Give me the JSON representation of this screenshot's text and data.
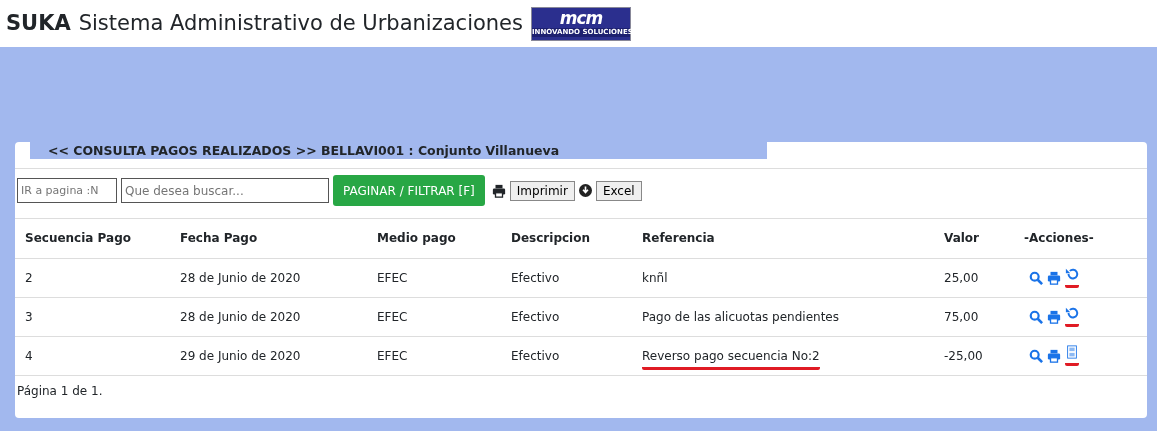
{
  "header": {
    "brand": "SUKA",
    "title": "Sistema Administrativo de Urbanizaciones",
    "logo": {
      "name": "mcm",
      "tagline": "INNOVANDO SOLUCIONES"
    }
  },
  "panel": {
    "title": "<< CONSULTA PAGOS REALIZADOS >> BELLAVI001 : Conjunto Villanueva"
  },
  "toolbar": {
    "page_field": {
      "placeholder": "IR a pagina :N"
    },
    "search_field": {
      "placeholder": "Que desea buscar..."
    },
    "filter_button": "PAGINAR / FILTRAR [F]",
    "print_button": "Imprimir",
    "excel_button": "Excel"
  },
  "table": {
    "columns": [
      "Secuencia Pago",
      "Fecha Pago",
      "Medio pago",
      "Descripcion",
      "Referencia",
      "Valor",
      "-Acciones-"
    ],
    "rows": [
      {
        "cells": [
          "2",
          "28 de Junio de 2020",
          "EFEC",
          "Efectivo",
          "knñl",
          "25,00"
        ],
        "reference_underlined": false,
        "actions": [
          {
            "kind": "search"
          },
          {
            "kind": "print"
          },
          {
            "kind": "reverse",
            "underlined": true
          }
        ]
      },
      {
        "cells": [
          "3",
          "28 de Junio de 2020",
          "EFEC",
          "Efectivo",
          "Pago de las alicuotas pendientes",
          "75,00"
        ],
        "reference_underlined": false,
        "actions": [
          {
            "kind": "search"
          },
          {
            "kind": "print"
          },
          {
            "kind": "reverse",
            "underlined": true
          }
        ]
      },
      {
        "cells": [
          "4",
          "29 de Junio de 2020",
          "EFEC",
          "Efectivo",
          "Reverso pago secuencia No:2",
          "-25,00"
        ],
        "reference_underlined": true,
        "actions": [
          {
            "kind": "search"
          },
          {
            "kind": "print"
          },
          {
            "kind": "missing",
            "underlined": true
          }
        ]
      }
    ]
  },
  "footer": "Página 1 de 1."
}
